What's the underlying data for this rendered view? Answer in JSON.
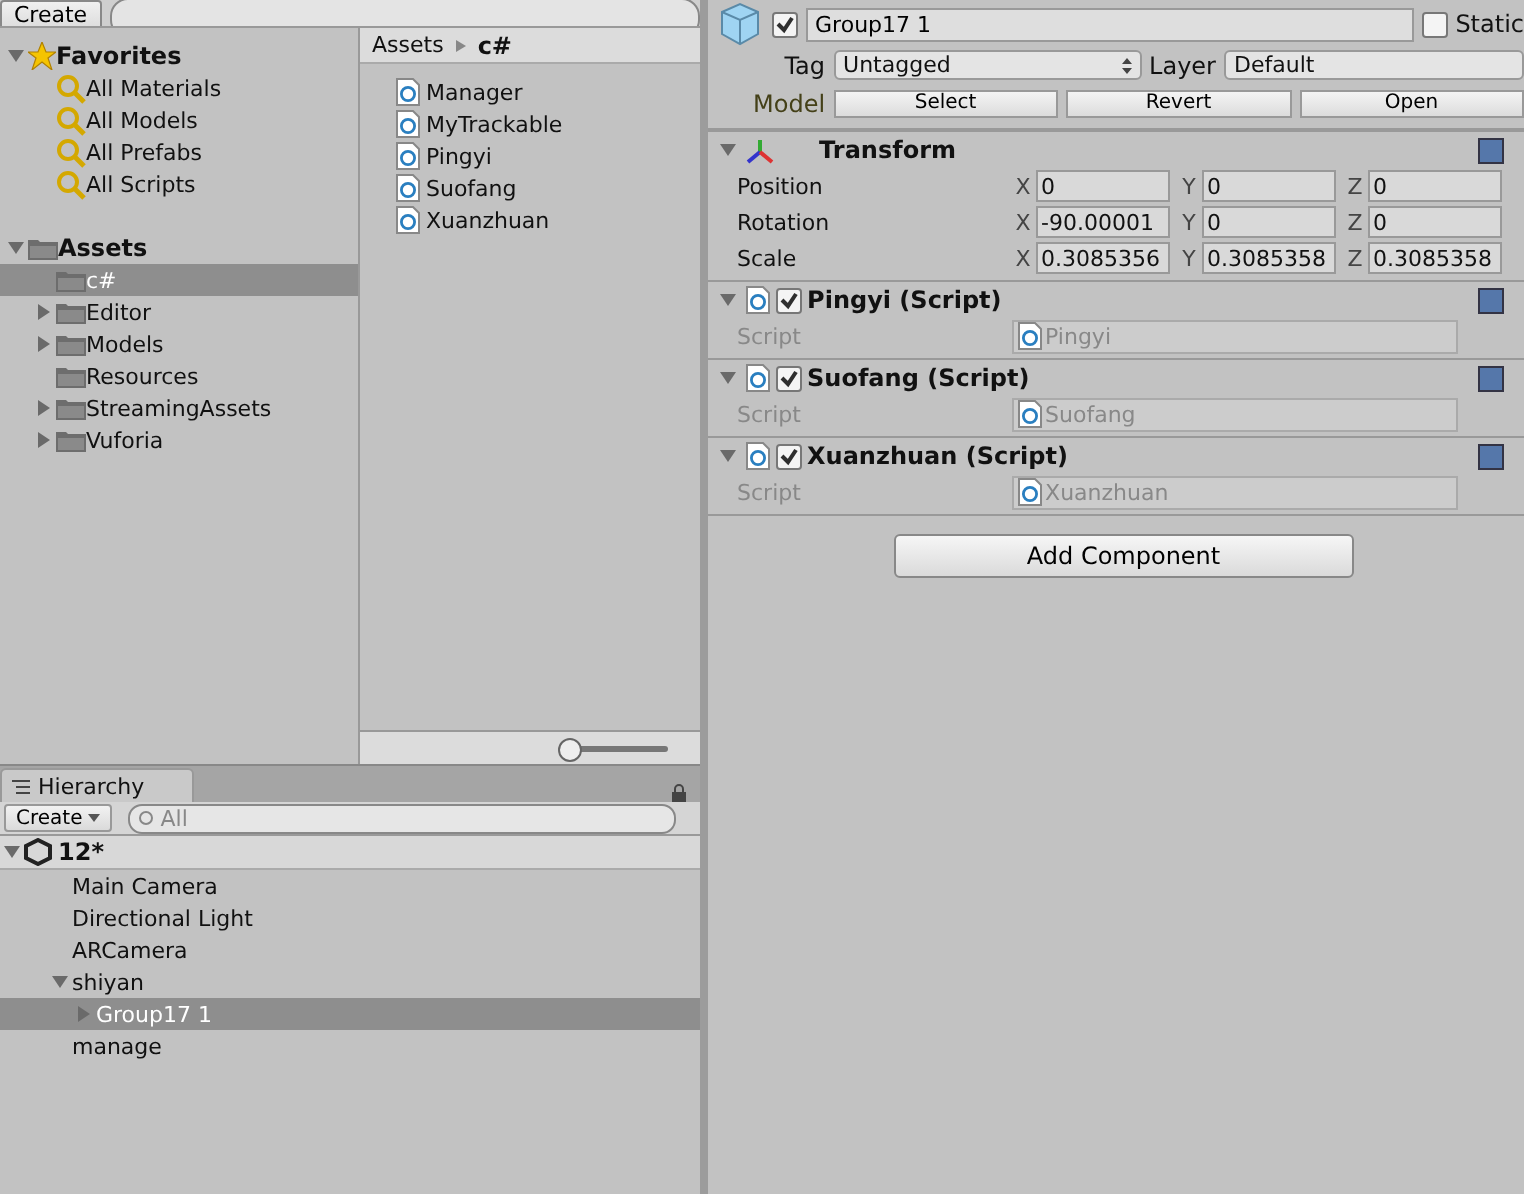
{
  "project": {
    "create_button": "Create",
    "favorites": {
      "label": "Favorites",
      "expanded": true,
      "items": [
        "All Materials",
        "All Models",
        "All Prefabs",
        "All Scripts"
      ]
    },
    "assets": {
      "label": "Assets",
      "expanded": true,
      "children": [
        {
          "label": "c#",
          "selected": true,
          "expandable": false
        },
        {
          "label": "Editor",
          "selected": false,
          "expandable": true
        },
        {
          "label": "Models",
          "selected": false,
          "expandable": true
        },
        {
          "label": "Resources",
          "selected": false,
          "expandable": false
        },
        {
          "label": "StreamingAssets",
          "selected": false,
          "expandable": true
        },
        {
          "label": "Vuforia",
          "selected": false,
          "expandable": true
        }
      ]
    },
    "breadcrumb": [
      "Assets",
      "c#"
    ],
    "files": [
      "Manager",
      "MyTrackable",
      "Pingyi",
      "Suofang",
      "Xuanzhuan"
    ],
    "zoom_slider": {
      "level": 0
    }
  },
  "hierarchy": {
    "tab": "Hierarchy",
    "create_button": "Create",
    "search": {
      "placeholder": "All"
    },
    "scene": {
      "label": "12*",
      "expanded": true
    },
    "items": [
      {
        "label": "Main Camera",
        "selected": false
      },
      {
        "label": "Directional Light",
        "selected": false
      },
      {
        "label": "ARCamera",
        "selected": false
      },
      {
        "label": "shiyan",
        "selected": false,
        "expanded": true,
        "children": [
          {
            "label": "Group17 1",
            "selected": true,
            "expanded": false,
            "expandable": true
          }
        ]
      },
      {
        "label": "manage",
        "selected": false
      }
    ]
  },
  "inspector": {
    "active": true,
    "name": "Group17 1",
    "static": false,
    "static_label": "Static",
    "tag_label": "Tag",
    "tag": "Untagged",
    "layer_label": "Layer",
    "layer": "Default",
    "model_label": "Model",
    "model_buttons": [
      "Select",
      "Revert",
      "Open"
    ],
    "components": [
      {
        "kind": "transform",
        "title": "Transform",
        "expanded": true,
        "rows": [
          {
            "label": "Position",
            "values": [
              {
                "axis": "X",
                "value": "0"
              },
              {
                "axis": "Y",
                "value": "0"
              },
              {
                "axis": "Z",
                "value": "0"
              }
            ]
          },
          {
            "label": "Rotation",
            "values": [
              {
                "axis": "X",
                "value": "-90.00001"
              },
              {
                "axis": "Y",
                "value": "0"
              },
              {
                "axis": "Z",
                "value": "0"
              }
            ]
          },
          {
            "label": "Scale",
            "values": [
              {
                "axis": "X",
                "value": "0.3085356"
              },
              {
                "axis": "Y",
                "value": "0.3085358"
              },
              {
                "axis": "Z",
                "value": "0.3085358"
              }
            ]
          }
        ]
      },
      {
        "kind": "script",
        "title": "Pingyi (Script)",
        "enabled": true,
        "expanded": true,
        "field_label": "Script",
        "value": "Pingyi"
      },
      {
        "kind": "script",
        "title": "Suofang (Script)",
        "enabled": true,
        "expanded": true,
        "field_label": "Script",
        "value": "Suofang"
      },
      {
        "kind": "script",
        "title": "Xuanzhuan (Script)",
        "enabled": true,
        "expanded": true,
        "field_label": "Script",
        "value": "Xuanzhuan"
      }
    ],
    "add_component": "Add Component"
  }
}
